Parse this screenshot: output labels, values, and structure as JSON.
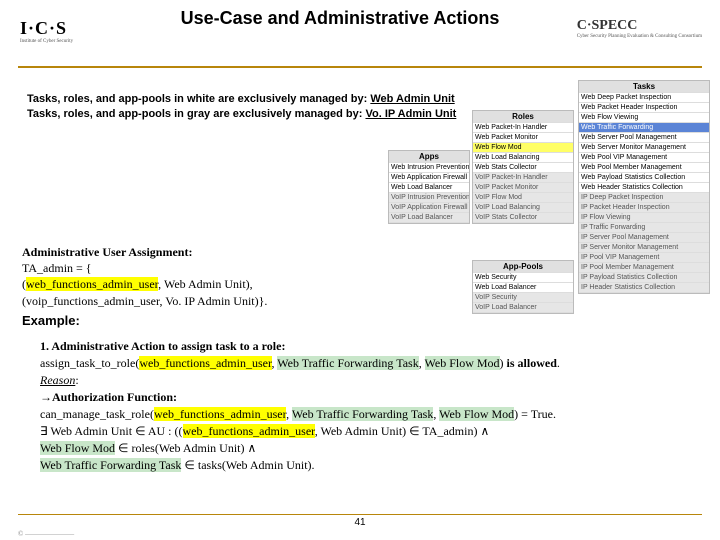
{
  "logos": {
    "left": "I·C·S",
    "left_sub": "Institute of Cyber Security",
    "right": "C·SPECC",
    "right_sub": "Cyber Security Planning Evaluation & Consulting Consortium"
  },
  "title": "Use-Case and Administrative Actions",
  "managed": {
    "l1a": "Tasks, roles, and app-pools in white are exclusively managed by: ",
    "l1b": "Web Admin Unit",
    "l2a": "Tasks, roles, and app-pools in gray are exclusively managed by:  ",
    "l2b": "Vo. IP Admin Unit"
  },
  "aua": {
    "h": "Administrative User Assignment:",
    "l1": "TA_admin = {",
    "l2a": "(",
    "l2h": "web_functions_admin_user",
    "l2b": ", Web Admin Unit),",
    "l3": "(voip_functions_admin_user, Vo. IP Admin Unit)}."
  },
  "example": "Example:",
  "ex": {
    "t1b": "1.  Administrative Action to assign task to a role:",
    "a": "assign_task_to_role(",
    "h1": "web_functions_admin_user",
    "c1": ", ",
    "g1": "Web Traffic Forwarding Task",
    "c2": ", ",
    "g2": "Web Flow Mod",
    "end": ") ",
    "allow": "is allowed",
    "r": "Reason",
    "rc": ":",
    "arrow": "→",
    "af": "Authorization Function:",
    "cm": "can_manage_task_role(",
    "h2": "web_functions_admin_user",
    "c3": ", ",
    "g3": "Web Traffic Forwarding Task",
    "c4": ", ",
    "g4": "Web Flow Mod",
    "tr": ") = True.",
    "exists": "∃ Web Admin Unit ",
    "in": "∈",
    " au": " AU : ((",
    "h3": "web_functions_admin_user",
    "pa": ", Web Admin Unit) ",
    "in2": "∈",
    " ta": " TA_admin)  ",
    "and": "∧",
    "l6a": "Web Flow Mod",
    "l6b": " ∈ roles(Web Admin Unit)  ∧",
    "l7a": "Web Traffic Forwarding Task",
    "l7b": " ∈ tasks(Web Admin Unit)."
  },
  "page": "41",
  "cols": {
    "tasks": {
      "h": "Tasks",
      "items": [
        "Web Deep Packet Inspection",
        "Web Packet Header Inspection",
        "Web Flow Viewing",
        "Web Traffic Forwarding",
        "Web Server Pool Management",
        "Web Server Monitor Management",
        "Web Pool VIP Management",
        "Web Pool Member Management",
        "Web Payload Statistics Collection",
        "Web Header Statistics Collection",
        "IP Deep Packet Inspection",
        "IP Packet Header Inspection",
        "IP Flow Viewing",
        "IP Traffic Forwarding",
        "IP Server Pool Management",
        "IP Server Monitor Management",
        "IP Pool VIP Management",
        "IP Pool Member Management",
        "IP Payload Statistics Collection",
        "IP Header Statistics Collection"
      ],
      "hl": 3,
      "grayFrom": 10
    },
    "roles": {
      "h": "Roles",
      "items": [
        "Web Packet-In Handler",
        "Web Packet Monitor",
        "Web Flow Mod",
        "Web Load Balancing",
        "Web Stats Collector",
        "VoIP Packet-In Handler",
        "VoIP Packet Monitor",
        "VoIP Flow Mod",
        "VoIP Load Balancing",
        "VoIP Stats Collector"
      ],
      "yl": 2,
      "grayFrom": 5
    },
    "apps": {
      "h": "Apps",
      "items": [
        "Web Intrusion Prevention",
        "Web Application Firewall",
        "Web Load Balancer",
        "VoIP Intrusion Prevention",
        "VoIP Application Firewall",
        "VoIP Load Balancer"
      ],
      "grayFrom": 3
    },
    "pools": {
      "h": "App-Pools",
      "items": [
        "Web Security",
        "Web Load Balancer",
        "VoIP Security",
        "VoIP Load Balancer"
      ],
      "grayFrom": 2
    }
  }
}
